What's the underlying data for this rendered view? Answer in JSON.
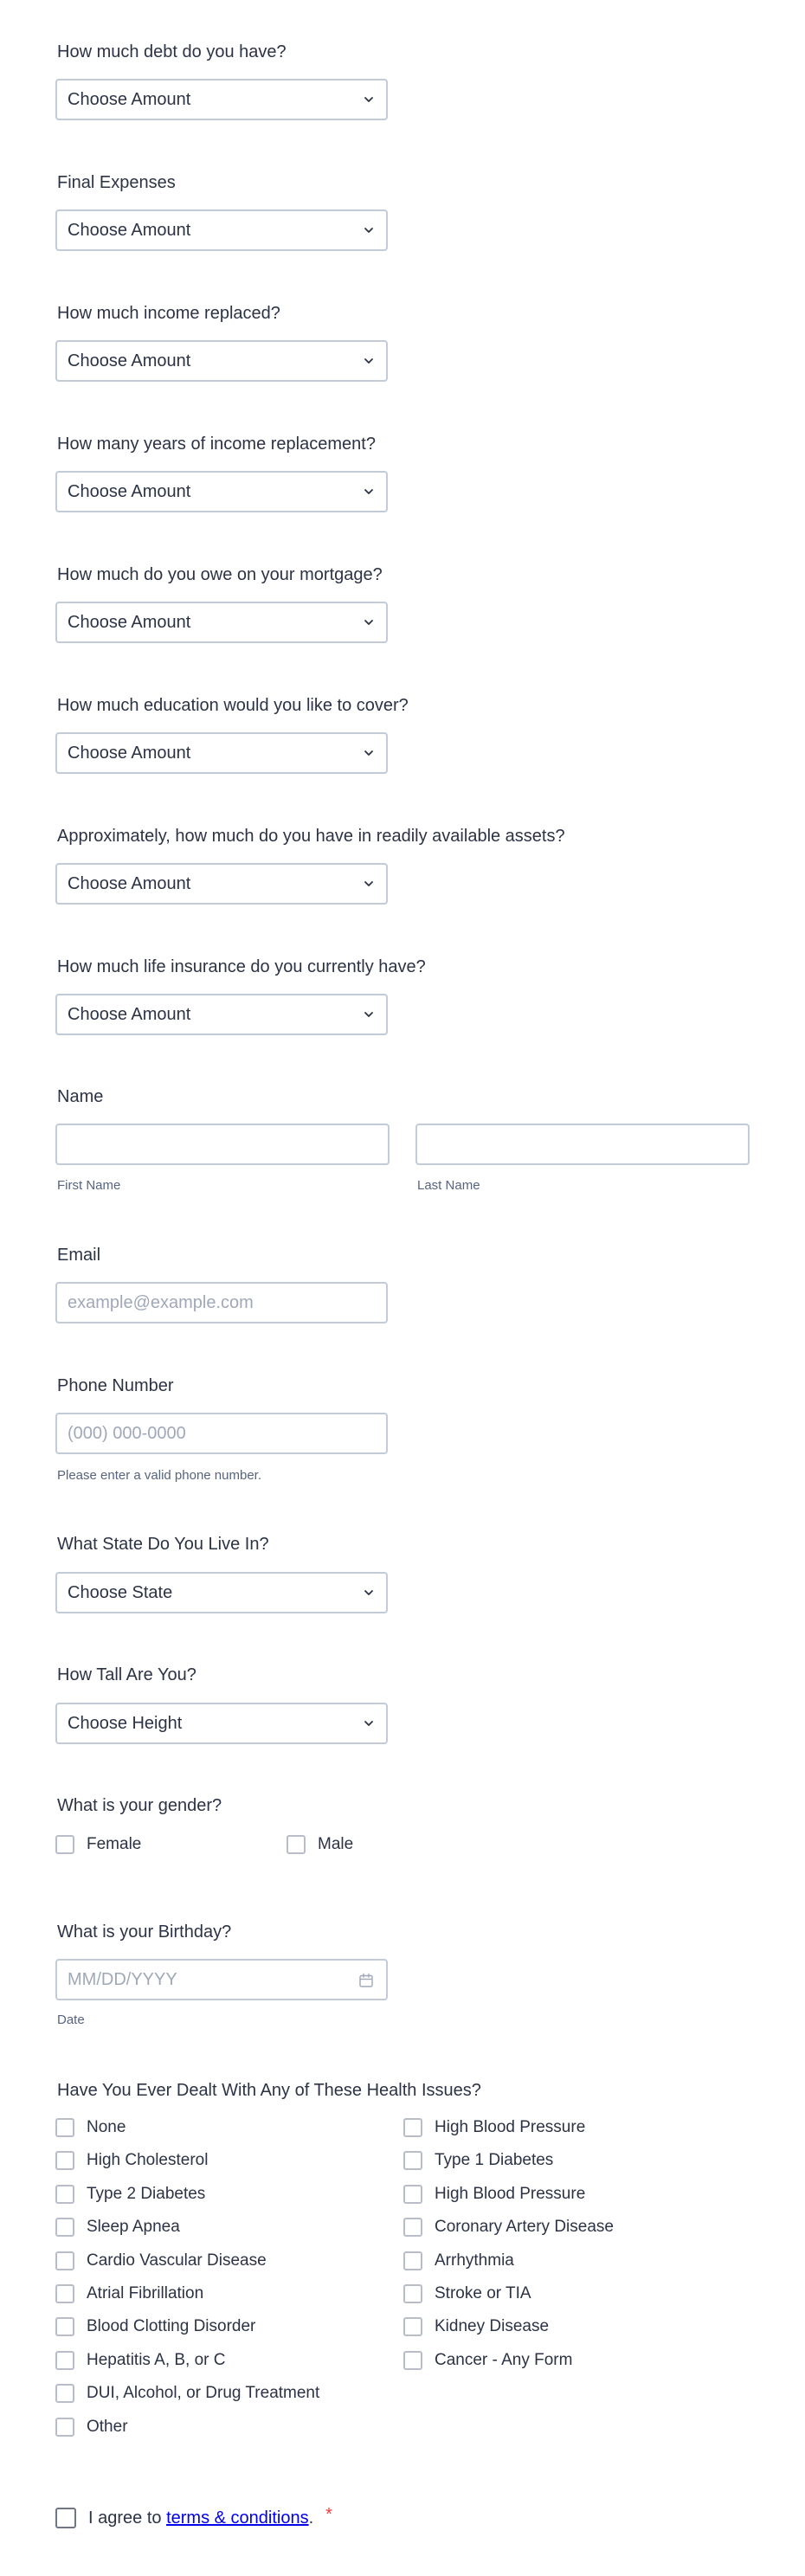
{
  "amount_questions": [
    {
      "label": "How much debt do you have?",
      "value": "Choose Amount"
    },
    {
      "label": "Final Expenses",
      "value": "Choose Amount"
    },
    {
      "label": "How much income replaced?",
      "value": "Choose Amount"
    },
    {
      "label": "How many years of income replacement?",
      "value": "Choose Amount"
    },
    {
      "label": "How much do you owe on your mortgage?",
      "value": "Choose Amount"
    },
    {
      "label": "How much education would you like to cover?",
      "value": "Choose Amount"
    },
    {
      "label": "Approximately, how much do you have in readily available assets?",
      "value": "Choose Amount"
    },
    {
      "label": "How much life insurance do you currently have?",
      "value": "Choose Amount"
    }
  ],
  "name": {
    "label": "Name",
    "first_sublabel": "First Name",
    "last_sublabel": "Last Name",
    "first_value": "",
    "last_value": ""
  },
  "email": {
    "label": "Email",
    "placeholder": "example@example.com"
  },
  "phone": {
    "label": "Phone Number",
    "placeholder": "(000) 000-0000",
    "hint": "Please enter a valid phone number."
  },
  "state": {
    "label": "What State Do You Live In?",
    "value": "Choose State"
  },
  "height": {
    "label": "How Tall Are You?",
    "value": "Choose Height"
  },
  "gender": {
    "label": "What is your gender?",
    "options": [
      "Female",
      "Male"
    ]
  },
  "birthday": {
    "label": "What is your Birthday?",
    "placeholder": "MM/DD/YYYY",
    "sublabel": "Date"
  },
  "health": {
    "label": "Have You Ever Dealt With Any of These Health Issues?",
    "left": [
      "None",
      "High Cholesterol",
      "Type 2 Diabetes",
      "Sleep Apnea",
      "Cardio Vascular Disease",
      "Atrial Fibrillation",
      "Blood Clotting Disorder",
      "Hepatitis A, B, or C",
      "DUI, Alcohol, or Drug Treatment",
      "Other"
    ],
    "right": [
      "High Blood Pressure",
      "Type 1 Diabetes",
      "High Blood Pressure",
      "Coronary Artery Disease",
      "Arrhythmia",
      "Stroke or TIA",
      "Kidney Disease",
      "Cancer - Any Form"
    ]
  },
  "terms": {
    "prefix": "I agree to ",
    "link_text": "terms & conditions",
    "suffix": ".",
    "required_mark": "*"
  },
  "colors": {
    "text": "#2c3345",
    "border": "#c3cad8",
    "placeholder": "#a0a8b8",
    "required": "#f23a3c",
    "link": "#0000ee"
  },
  "icons": {
    "select": "chevron-down-icon",
    "birthday": "calendar-icon"
  }
}
